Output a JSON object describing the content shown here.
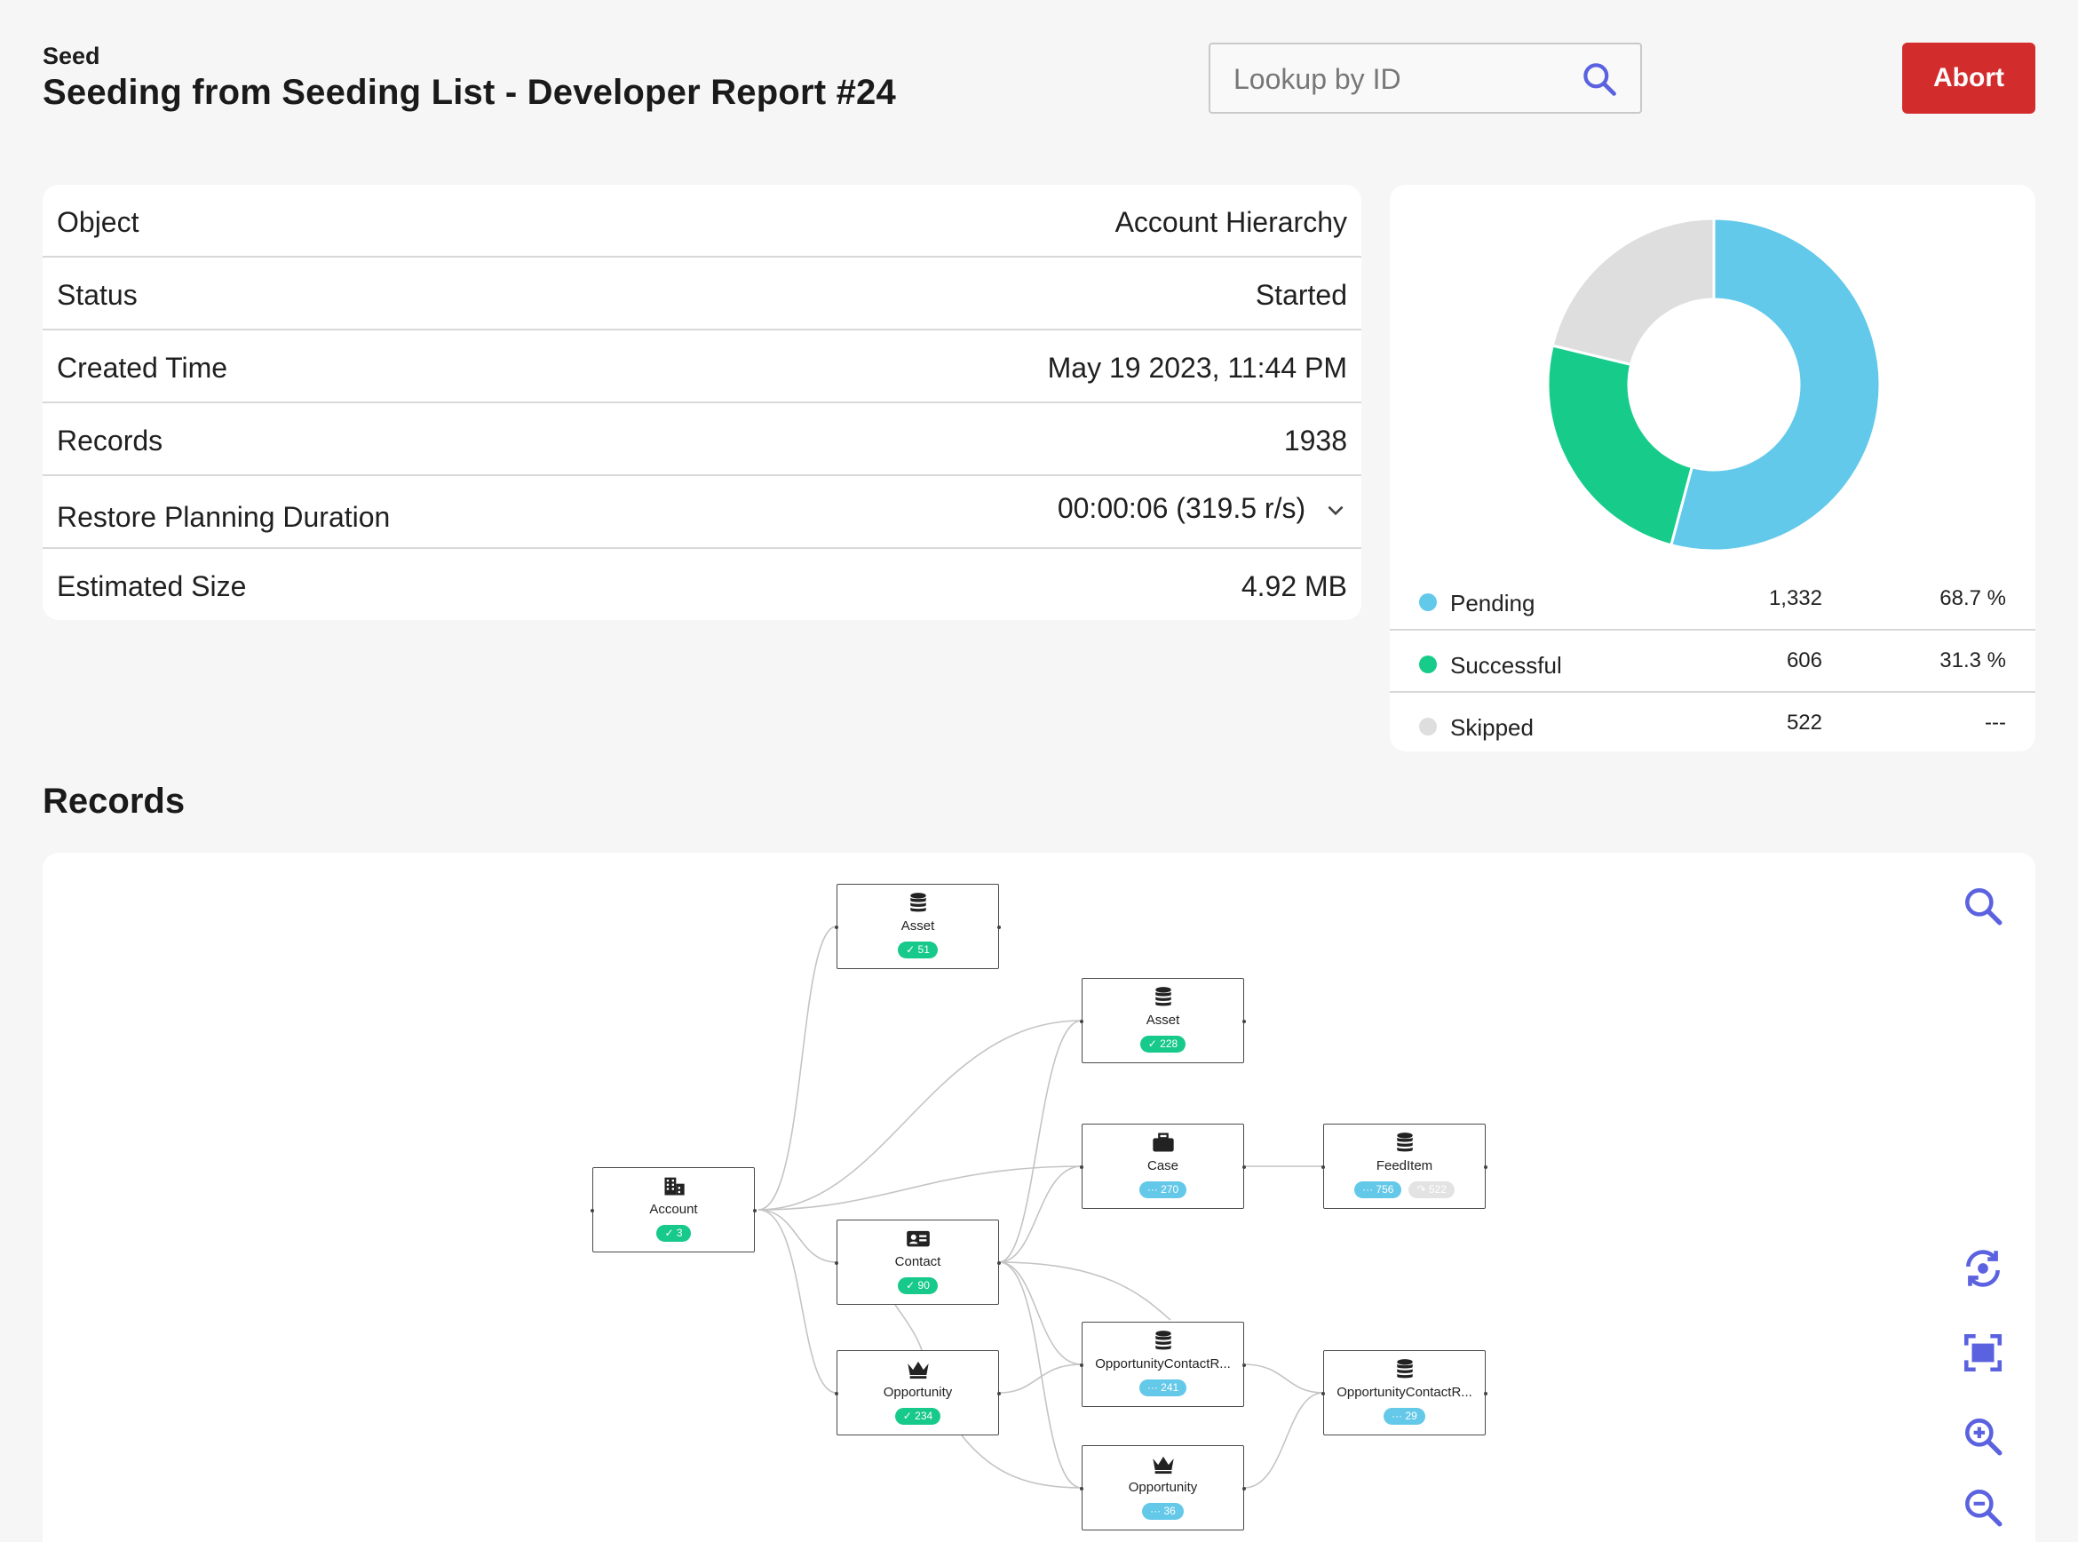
{
  "header": {
    "eyebrow": "Seed",
    "title": "Seeding from Seeding List - Developer Report #24",
    "lookup_placeholder": "Lookup by ID",
    "abort_label": "Abort"
  },
  "details": [
    {
      "label": "Object",
      "value": "Account Hierarchy"
    },
    {
      "label": "Status",
      "value": "Started"
    },
    {
      "label": "Created Time",
      "value": "May 19 2023, 11:44 PM"
    },
    {
      "label": "Records",
      "value": "1938"
    },
    {
      "label": "Restore Planning Duration",
      "value": "00:00:06 (319.5 r/s)"
    },
    {
      "label": "Estimated Size",
      "value": "4.92 MB"
    }
  ],
  "summary": {
    "legend": [
      {
        "name": "Pending",
        "count": "1,332",
        "percent": "68.7 %",
        "color": "#62c9ea"
      },
      {
        "name": "Successful",
        "count": "606",
        "percent": "31.3 %",
        "color": "#17cc8a"
      },
      {
        "name": "Skipped",
        "count": "522",
        "percent": "---",
        "color": "#dedede"
      }
    ]
  },
  "chart_data": {
    "type": "pie",
    "categories": [
      "Pending",
      "Successful",
      "Skipped"
    ],
    "values": [
      1332,
      606,
      522
    ],
    "colors": [
      "#62c9ea",
      "#17cc8a",
      "#dedede"
    ],
    "donut": true
  },
  "records": {
    "title": "Records",
    "nodes": {
      "account": {
        "label": "Account",
        "badges": [
          {
            "kind": "green",
            "text": "✓ 3"
          }
        ],
        "icon": "building-icon"
      },
      "asset1": {
        "label": "Asset",
        "badges": [
          {
            "kind": "green",
            "text": "✓ 51"
          }
        ],
        "icon": "database-icon"
      },
      "asset2": {
        "label": "Asset",
        "badges": [
          {
            "kind": "green",
            "text": "✓ 228"
          }
        ],
        "icon": "database-icon"
      },
      "case": {
        "label": "Case",
        "badges": [
          {
            "kind": "blue",
            "text": "··· 270"
          }
        ],
        "icon": "briefcase-icon"
      },
      "feeditem": {
        "label": "FeedItem",
        "badges": [
          {
            "kind": "blue",
            "text": "··· 756"
          },
          {
            "kind": "gray",
            "text": "↷ 522"
          }
        ],
        "icon": "database-icon"
      },
      "contact": {
        "label": "Contact",
        "badges": [
          {
            "kind": "green",
            "text": "✓ 90"
          }
        ],
        "icon": "id-card-icon"
      },
      "opp1": {
        "label": "Opportunity",
        "badges": [
          {
            "kind": "green",
            "text": "✓ 234"
          }
        ],
        "icon": "crown-icon"
      },
      "ocr1": {
        "label": "OpportunityContactR...",
        "badges": [
          {
            "kind": "blue",
            "text": "··· 241"
          }
        ],
        "icon": "database-icon"
      },
      "ocr2": {
        "label": "OpportunityContactR...",
        "badges": [
          {
            "kind": "blue",
            "text": "··· 29"
          }
        ],
        "icon": "database-icon"
      },
      "opp2": {
        "label": "Opportunity",
        "badges": [
          {
            "kind": "blue",
            "text": "··· 36"
          }
        ],
        "icon": "crown-icon"
      }
    },
    "tools": [
      "search-icon",
      "reset-view-icon",
      "fit-screen-icon",
      "zoom-in-icon",
      "zoom-out-icon"
    ]
  }
}
